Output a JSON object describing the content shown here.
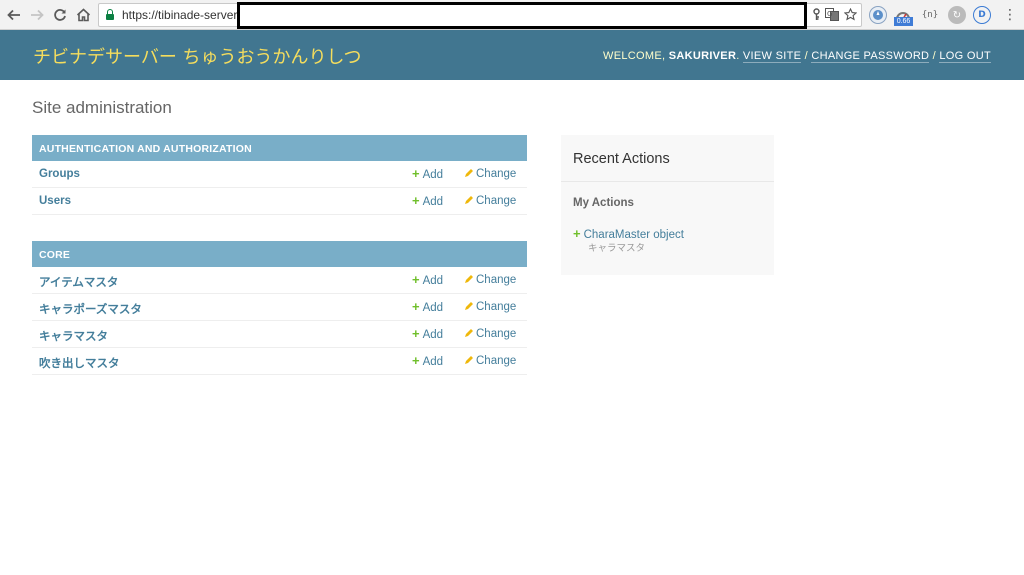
{
  "browser": {
    "url": "https://tibinade-server",
    "back_icon": "arrow-left-icon",
    "forward_icon": "arrow-right-icon",
    "reload_icon": "reload-icon",
    "home_icon": "home-icon",
    "badge": "0.66"
  },
  "header": {
    "branding": "チビナデサーバー ちゅうおうかんりしつ",
    "welcome": "WELCOME,",
    "username": "SAKURIVER",
    "view_site": "VIEW SITE",
    "change_password": "CHANGE PASSWORD",
    "log_out": "LOG OUT",
    "separator": "/"
  },
  "page_title": "Site administration",
  "modules": [
    {
      "caption": "AUTHENTICATION AND AUTHORIZATION",
      "models": [
        {
          "name": "Groups",
          "add": "Add",
          "change": "Change"
        },
        {
          "name": "Users",
          "add": "Add",
          "change": "Change"
        }
      ]
    },
    {
      "caption": "CORE",
      "models": [
        {
          "name": "アイテムマスタ",
          "add": "Add",
          "change": "Change"
        },
        {
          "name": "キャラポーズマスタ",
          "add": "Add",
          "change": "Change"
        },
        {
          "name": "キャラマスタ",
          "add": "Add",
          "change": "Change"
        },
        {
          "name": "吹き出しマスタ",
          "add": "Add",
          "change": "Change"
        }
      ]
    }
  ],
  "recent_actions": {
    "title": "Recent Actions",
    "subtitle": "My Actions",
    "items": [
      {
        "label": "CharaMaster object",
        "type": "キャラマスタ",
        "icon": "plus-icon"
      }
    ]
  },
  "colors": {
    "header_bg": "#417690",
    "branding": "#f5dd5d",
    "module_caption_bg": "#79aec8",
    "link": "#447e9b",
    "add_icon": "#70bf2b",
    "change_icon": "#efb80b"
  }
}
